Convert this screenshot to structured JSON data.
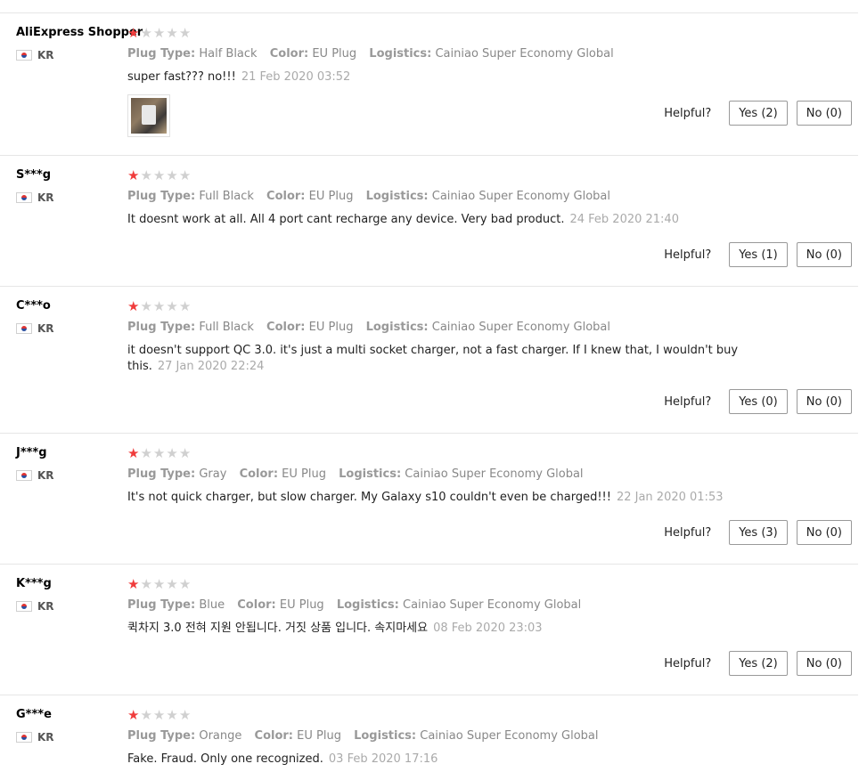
{
  "labels": {
    "plug_type": "Plug Type:",
    "color": "Color:",
    "logistics": "Logistics:",
    "helpful": "Helpful?"
  },
  "colors": {
    "star_filled": "#f03c3c",
    "star_empty": "#d0d0d0",
    "divider": "#e6e6e6"
  },
  "reviews": [
    {
      "user": "AliExpress Shopper",
      "country": "KR",
      "rating": 1,
      "plug_type": "Half Black",
      "color": "EU Plug",
      "logistics": "Cainiao Super Economy Global",
      "comment": "super fast??? no!!!",
      "date": "21 Feb 2020 03:52",
      "has_photo": true,
      "yes": "Yes (2)",
      "no": "No (0)"
    },
    {
      "user": "S***g",
      "country": "KR",
      "rating": 1,
      "plug_type": "Full Black",
      "color": "EU Plug",
      "logistics": "Cainiao Super Economy Global",
      "comment": "It doesnt work at all. All 4 port cant recharge any device. Very bad product.",
      "date": "24 Feb 2020 21:40",
      "yes": "Yes (1)",
      "no": "No (0)"
    },
    {
      "user": "C***o",
      "country": "KR",
      "rating": 1,
      "plug_type": "Full Black",
      "color": "EU Plug",
      "logistics": "Cainiao Super Economy Global",
      "comment": "it doesn't support QC 3.0. it's just a multi socket charger, not a fast charger. If I knew that, I wouldn't buy this.",
      "date": "27 Jan 2020 22:24",
      "yes": "Yes (0)",
      "no": "No (0)"
    },
    {
      "user": "J***g",
      "country": "KR",
      "rating": 1,
      "plug_type": "Gray",
      "color": "EU Plug",
      "logistics": "Cainiao Super Economy Global",
      "comment": "It's not quick charger, but slow charger. My Galaxy s10 couldn't even be charged!!!",
      "date": "22 Jan 2020 01:53",
      "yes": "Yes (3)",
      "no": "No (0)"
    },
    {
      "user": "K***g",
      "country": "KR",
      "rating": 1,
      "plug_type": "Blue",
      "color": "EU Plug",
      "logistics": "Cainiao Super Economy Global",
      "comment": "퀵차지 3.0 전혀 지원 안됩니다. 거짓 상품 입니다. 속지마세요",
      "date": "08 Feb 2020 23:03",
      "yes": "Yes (2)",
      "no": "No (0)"
    },
    {
      "user": "G***e",
      "country": "KR",
      "rating": 1,
      "plug_type": "Orange",
      "color": "EU Plug",
      "logistics": "Cainiao Super Economy Global",
      "comment": "Fake. Fraud. Only one recognized.",
      "date": "03 Feb 2020 17:16"
    }
  ]
}
